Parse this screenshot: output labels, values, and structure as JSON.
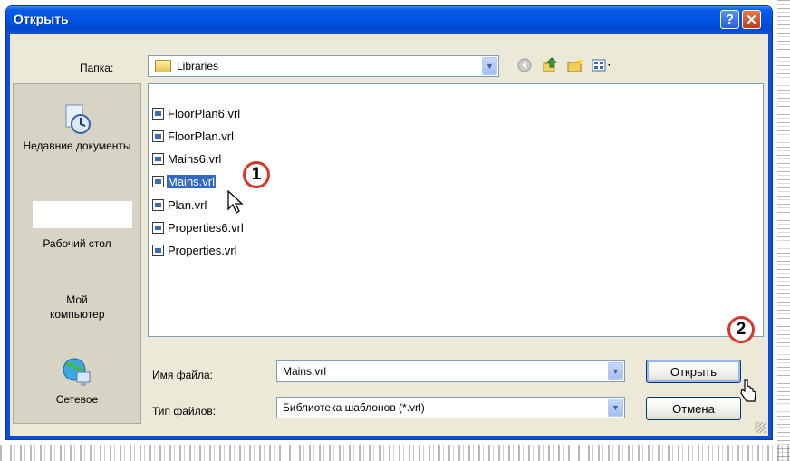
{
  "window": {
    "title": "Открыть"
  },
  "lookin": {
    "label": "Папка:",
    "value": "Libraries"
  },
  "places": [
    {
      "label": "Недавние документы",
      "icon": "recent-documents-icon"
    },
    {
      "label": "Рабочий стол",
      "icon": "desktop-icon"
    },
    {
      "label": "Мой компьютер",
      "icon": "my-computer-icon"
    },
    {
      "label": "Сетевое",
      "icon": "network-icon"
    }
  ],
  "files": [
    {
      "name": "FloorPlan6.vrl",
      "selected": false
    },
    {
      "name": "FloorPlan.vrl",
      "selected": false
    },
    {
      "name": "Mains6.vrl",
      "selected": false
    },
    {
      "name": "Mains.vrl",
      "selected": true
    },
    {
      "name": "Plan.vrl",
      "selected": false
    },
    {
      "name": "Properties6.vrl",
      "selected": false
    },
    {
      "name": "Properties.vrl",
      "selected": false
    }
  ],
  "filename": {
    "label": "Имя файла:",
    "value": "Mains.vrl"
  },
  "filetype": {
    "label": "Тип файлов:",
    "value": "Библиотека шаблонов (*.vrl)"
  },
  "buttons": {
    "open": "Открыть",
    "cancel": "Отмена",
    "help": "?",
    "close": "✕"
  },
  "annotations": {
    "step1": "1",
    "step2": "2"
  },
  "colors": {
    "title_bar": "#0054e3",
    "selection": "#316ac5",
    "badge_border": "#d8352a"
  }
}
